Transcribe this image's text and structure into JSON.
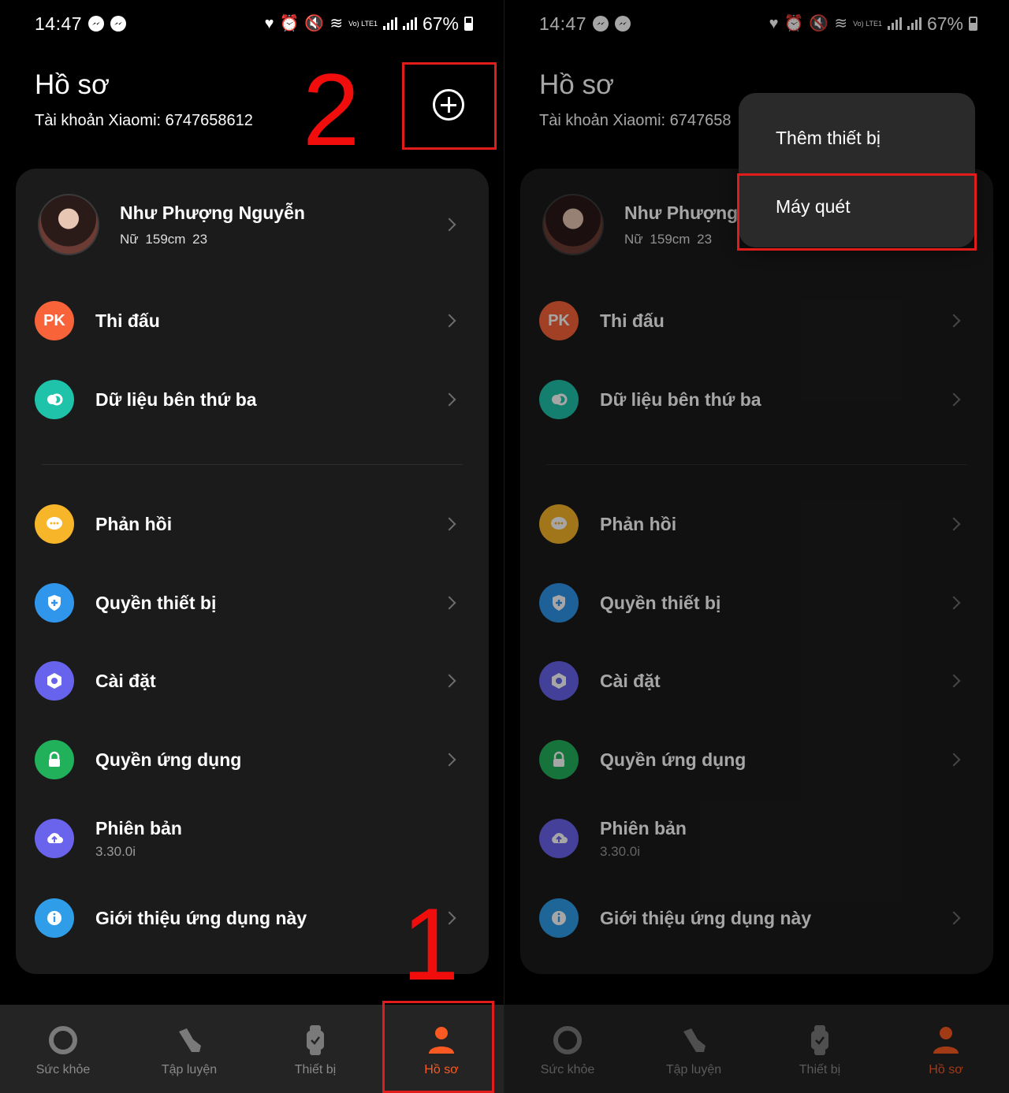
{
  "status": {
    "time": "14:47",
    "battery": "67%",
    "lte": "Vo) LTE1"
  },
  "header": {
    "title": "Hồ sơ",
    "account": "Tài khoản Xiaomi: 6747658612",
    "account_cropped": "Tài khoản Xiaomi: 6747658"
  },
  "profile": {
    "name": "Như Phượng Nguyễn",
    "name_cropped": "Như Phượng",
    "gender": "Nữ",
    "height": "159cm",
    "age": "23"
  },
  "menu": [
    {
      "label": "Thi đấu",
      "icon": "pk-icon",
      "color": "#f8633a"
    },
    {
      "label": "Dữ liệu bên thứ ba",
      "icon": "link-icon",
      "color": "#1fc3a9"
    },
    {
      "label": "Phản hồi",
      "icon": "chat-icon",
      "color": "#f7b52a"
    },
    {
      "label": "Quyền thiết bị",
      "icon": "shield-icon",
      "color": "#2f96ec"
    },
    {
      "label": "Cài đặt",
      "icon": "gear-icon",
      "color": "#6863ec"
    },
    {
      "label": "Quyền ứng dụng",
      "icon": "lock-icon",
      "color": "#22b15b"
    },
    {
      "label": "Phiên bản",
      "sub": "3.30.0i",
      "icon": "cloud-upload-icon",
      "color": "#6a63ec"
    },
    {
      "label": "Giới thiệu ứng dụng này",
      "icon": "info-icon",
      "color": "#2f9de8"
    }
  ],
  "pk_text": "PK",
  "nav": [
    {
      "label": "Sức khỏe",
      "icon": "ring-icon"
    },
    {
      "label": "Tập luyện",
      "icon": "shoe-icon"
    },
    {
      "label": "Thiết bị",
      "icon": "watch-icon"
    },
    {
      "label": "Hồ sơ",
      "icon": "person-icon",
      "active": true
    }
  ],
  "annotations": {
    "step1": "1",
    "step2": "2"
  },
  "popup": {
    "add_device": "Thêm thiết bị",
    "scanner": "Máy quét"
  },
  "colors": {
    "accent": "#fa5a22",
    "highlight": "#e21b1b",
    "card": "#1b1b1b",
    "nav": "#242424"
  }
}
